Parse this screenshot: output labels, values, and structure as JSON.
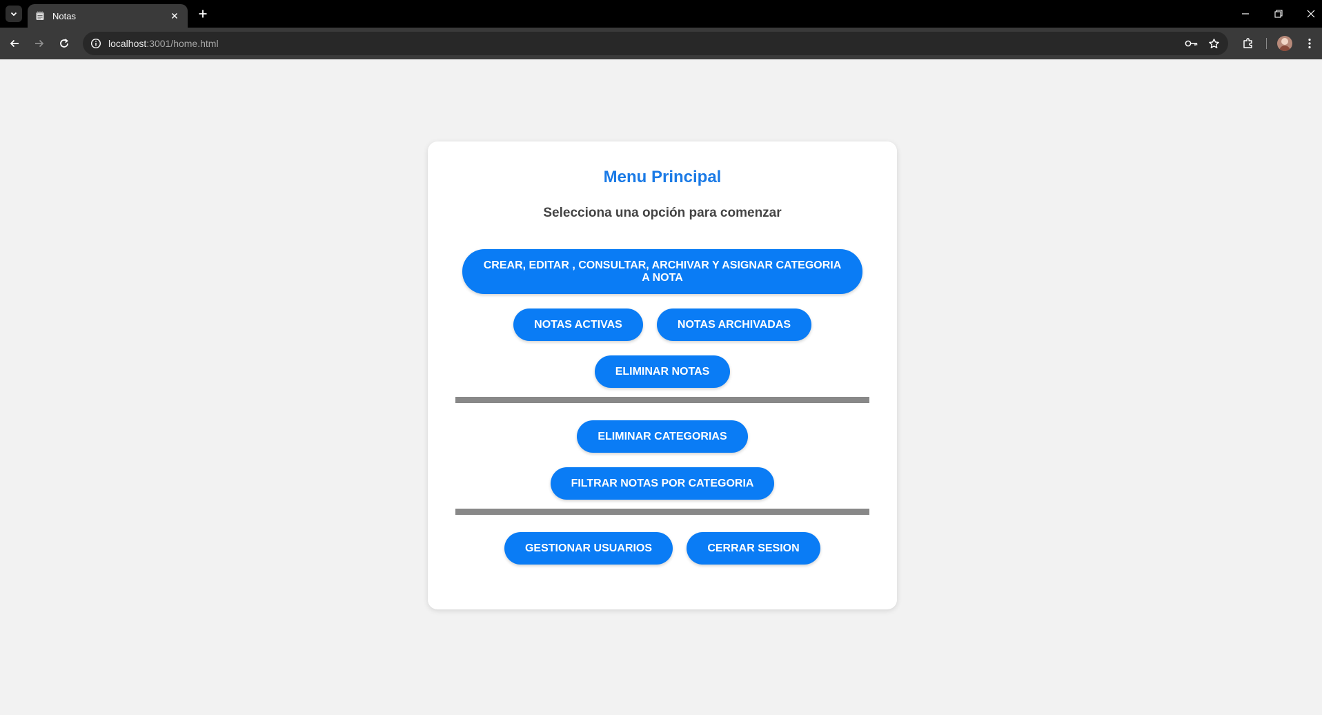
{
  "browser": {
    "tab_title": "Notas",
    "url_host": "localhost",
    "url_rest": ":3001/home.html"
  },
  "page": {
    "title": "Menu Principal",
    "subtitle": "Selecciona una opción para comenzar",
    "buttons": {
      "crear": "CREAR, EDITAR , CONSULTAR, ARCHIVAR Y ASIGNAR CATEGORIA A NOTA",
      "activas": "NOTAS ACTIVAS",
      "archivadas": "NOTAS ARCHIVADAS",
      "eliminar_notas": "ELIMINAR NOTAS",
      "eliminar_categorias": "ELIMINAR CATEGORIAS",
      "filtrar": "FILTRAR NOTAS POR CATEGORIA",
      "usuarios": "GESTIONAR USUARIOS",
      "cerrar": "CERRAR SESION"
    }
  },
  "colors": {
    "accent": "#0a7cf5",
    "title": "#1a7ae6",
    "divider": "#888888",
    "background": "#f2f2f2"
  }
}
